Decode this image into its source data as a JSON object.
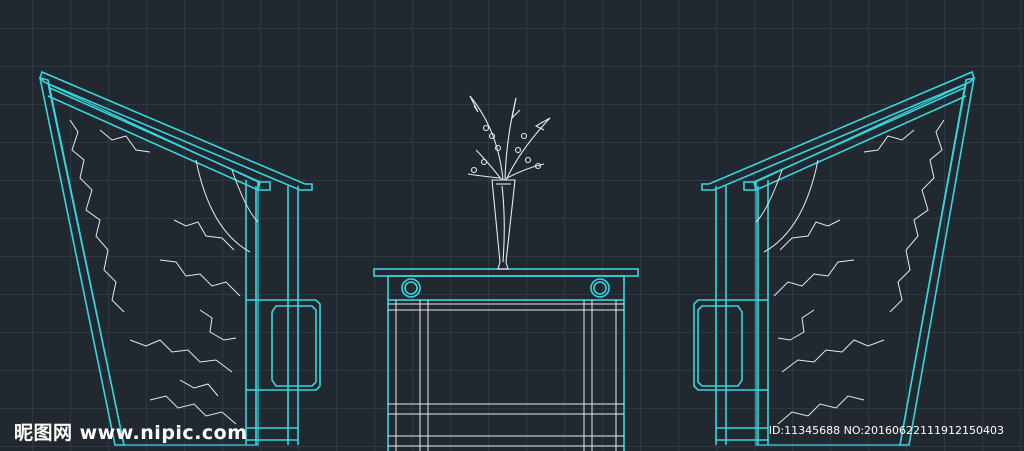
{
  "drawing": {
    "subject": "CAD elevation: two armchairs flanking a side table with a flower vase",
    "colors": {
      "background": "#212830",
      "grid": "#2f3944",
      "chair_outline": "#36d6df",
      "detail_lines": "#e6eaee",
      "watermark": "#ffffff"
    }
  },
  "watermark": {
    "site_text": "昵图网 www.nipic.com",
    "id_text": "ID:11345688 NO:20160622111912150403"
  }
}
